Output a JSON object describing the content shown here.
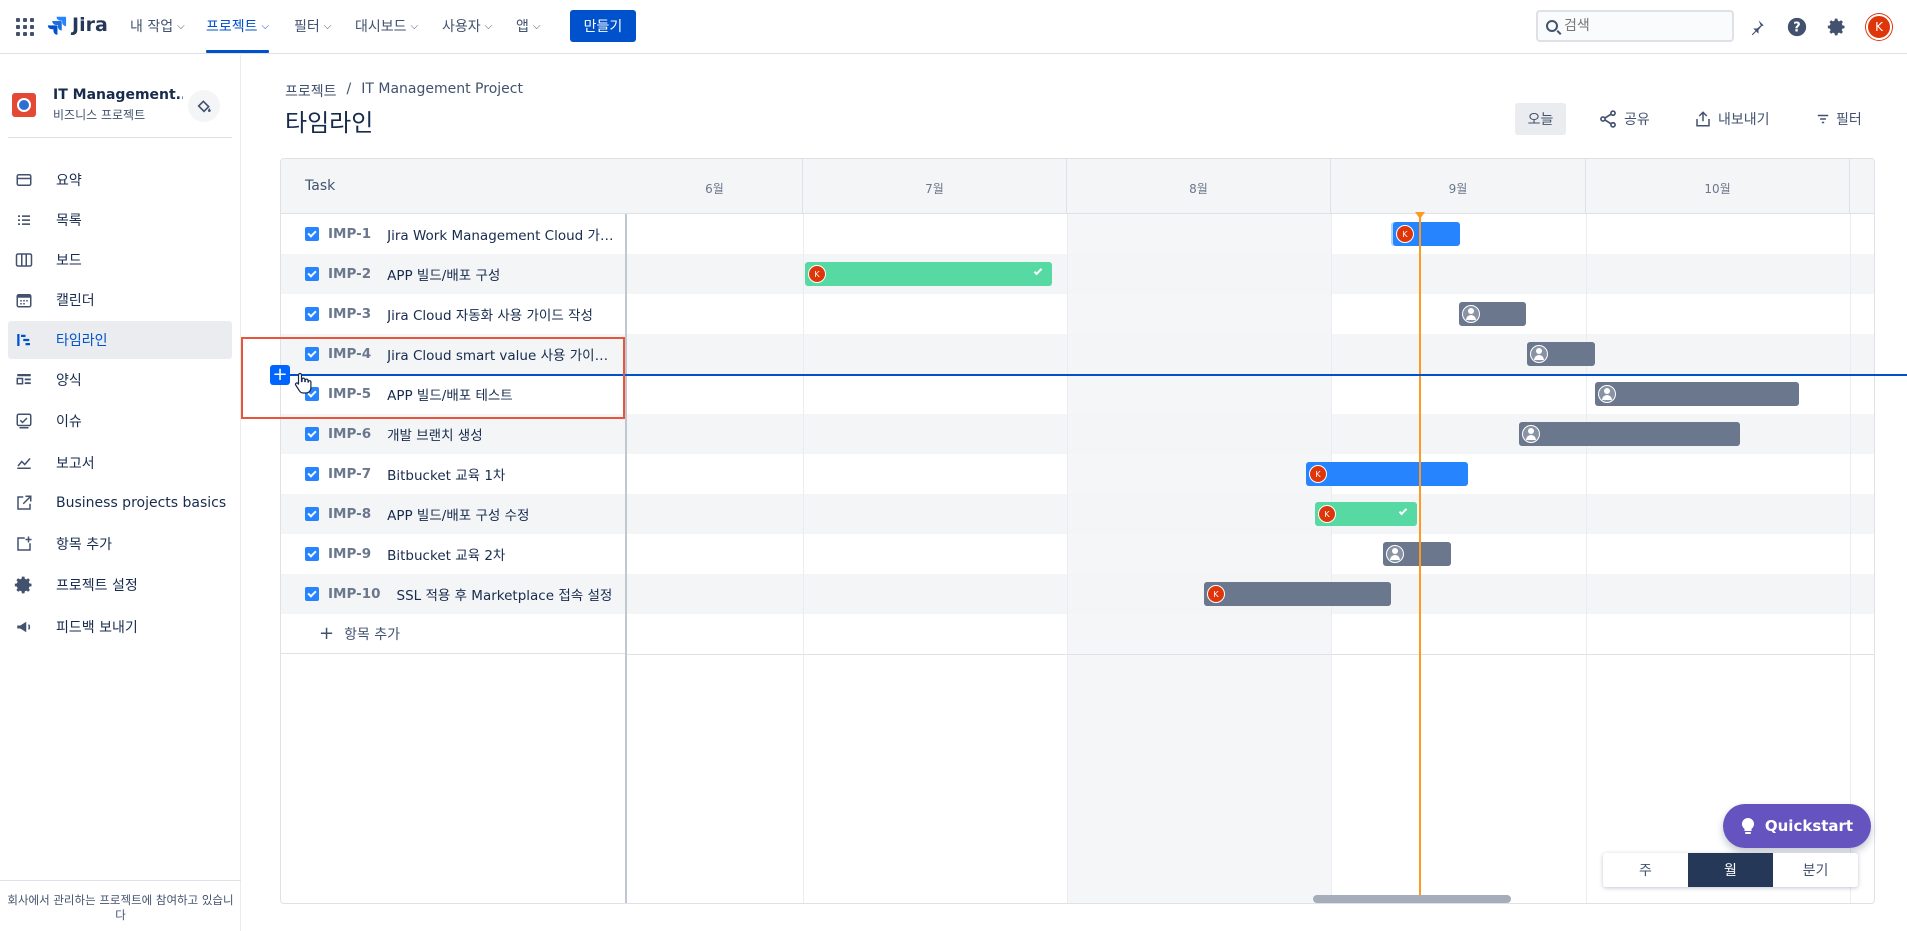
{
  "nav": {
    "logo": "Jira",
    "items": [
      {
        "label": "내 작업"
      },
      {
        "label": "프로젝트"
      },
      {
        "label": "필터"
      },
      {
        "label": "대시보드"
      },
      {
        "label": "사용자"
      },
      {
        "label": "앱"
      }
    ],
    "create_label": "만들기",
    "search_placeholder": "검색",
    "avatar_initial": "K"
  },
  "sidebar": {
    "project_name": "IT Management...",
    "project_type": "비즈니스 프로젝트",
    "items": [
      {
        "label": "요약"
      },
      {
        "label": "목록"
      },
      {
        "label": "보드"
      },
      {
        "label": "캘린더"
      },
      {
        "label": "타임라인"
      },
      {
        "label": "양식"
      },
      {
        "label": "이슈"
      },
      {
        "label": "보고서"
      },
      {
        "label": "Business projects basics"
      },
      {
        "label": "항목 추가"
      },
      {
        "label": "프로젝트 설정"
      },
      {
        "label": "피드백 보내기"
      }
    ],
    "footer": "회사에서 관리하는 프로젝트에 참여하고 있습니다"
  },
  "page": {
    "breadcrumb": [
      "프로젝트",
      "/",
      "IT Management Project"
    ],
    "title": "타임라인",
    "today_label": "오늘",
    "share_label": "공유",
    "export_label": "내보내기",
    "filter_label": "필터"
  },
  "timeline": {
    "task_header": "Task",
    "months": [
      "6월",
      "7월",
      "8월",
      "9월",
      "10월"
    ],
    "tasks": [
      {
        "key": "IMP-1",
        "summary": "Jira Work Management Cloud 가이..."
      },
      {
        "key": "IMP-2",
        "summary": "APP 빌드/배포 구성"
      },
      {
        "key": "IMP-3",
        "summary": "Jira Cloud 자동화 사용 가이드 작성"
      },
      {
        "key": "IMP-4",
        "summary": "Jira Cloud smart value 사용 가이드 ..."
      },
      {
        "key": "IMP-5",
        "summary": "APP 빌드/배포 테스트"
      },
      {
        "key": "IMP-6",
        "summary": "개발 브랜치 생성"
      },
      {
        "key": "IMP-7",
        "summary": "Bitbucket 교육 1차"
      },
      {
        "key": "IMP-8",
        "summary": "APP 빌드/배포 구성 수정"
      },
      {
        "key": "IMP-9",
        "summary": "Bitbucket 교육 2차"
      },
      {
        "key": "IMP-10",
        "summary": "SSL 적용 후 Marketplace 접속 설정"
      }
    ],
    "add_item_label": "항목 추가",
    "avatar_initial": "K"
  },
  "quickstart_label": "Quickstart",
  "zoom": {
    "options": [
      "주",
      "월",
      "분기"
    ],
    "selected": "월"
  },
  "colors": {
    "brand": "#0052cc",
    "in_progress": "#2684ff",
    "done": "#57d9a3",
    "todo": "#6b778c",
    "today": "#ff991f",
    "quickstart": "#6554c0"
  }
}
